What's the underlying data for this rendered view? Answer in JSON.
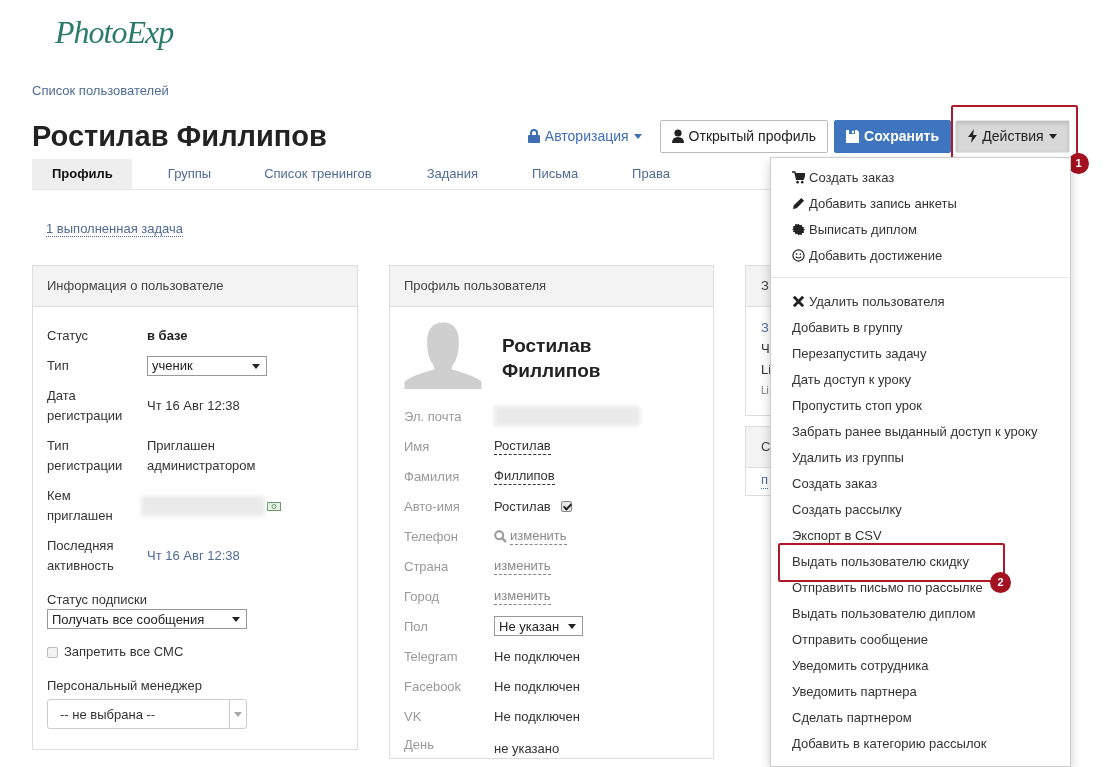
{
  "logo": {
    "text": "PhotoExp"
  },
  "breadcrumb": "Список пользователей",
  "title": "Ростилав Филлипов",
  "header_actions": {
    "auth": "Авторизация",
    "open_profile": "Открытый профиль",
    "save": "Сохранить",
    "actions": {
      "label": "Действия",
      "expanded": true,
      "annotation": "1"
    }
  },
  "tabs": [
    {
      "label": "Профиль",
      "selected": true
    },
    {
      "label": "Группы",
      "selected": false
    },
    {
      "label": "Список тренингов",
      "selected": false
    },
    {
      "label": "Задания",
      "selected": false
    },
    {
      "label": "Письма",
      "selected": false
    },
    {
      "label": "Права",
      "selected": false
    }
  ],
  "task_link": "1 выполненная задача",
  "info_panel": {
    "title": "Информация о пользователе",
    "rows": [
      {
        "kind": "bold",
        "label": "Статус",
        "value": "в базе"
      },
      {
        "kind": "select",
        "label": "Тип",
        "value": "ученик"
      },
      {
        "kind": "text",
        "label": "Дата регистрации",
        "value": "Чт 16 Авг 12:38"
      },
      {
        "kind": "text",
        "label": "Тип регистрации",
        "value": "Приглашен администратором"
      },
      {
        "kind": "redacted",
        "label": "Кем приглашен"
      },
      {
        "kind": "link",
        "label": "Последняя активность",
        "value": "Чт 16 Авг 12:38"
      }
    ],
    "subscription": {
      "label": "Статус подписки",
      "value": "Получать все сообщения"
    },
    "sms": {
      "label": "Запретить все СМС",
      "checked": false
    },
    "manager": {
      "label": "Персональный менеджер",
      "value": "-- не выбрана --"
    }
  },
  "profile_panel": {
    "title": "Профиль пользователя",
    "name": "Ростилав Филлипов",
    "rows": [
      {
        "kind": "redacted",
        "label": "Эл. почта"
      },
      {
        "kind": "editable",
        "label": "Имя",
        "value": "Ростилав"
      },
      {
        "kind": "editable",
        "label": "Фамилия",
        "value": "Филлипов"
      },
      {
        "kind": "check",
        "label": "Авто-имя",
        "value": "Ростилав",
        "checked": true
      },
      {
        "kind": "search",
        "label": "Телефон",
        "value": "изменить"
      },
      {
        "kind": "change",
        "label": "Страна",
        "value": "изменить"
      },
      {
        "kind": "change",
        "label": "Город",
        "value": "изменить"
      },
      {
        "kind": "select",
        "label": "Пол",
        "value": "Не указан"
      },
      {
        "kind": "text",
        "label": "Telegram",
        "value": "Не подключен"
      },
      {
        "kind": "text",
        "label": "Facebook",
        "value": "Не подключен"
      },
      {
        "kind": "text",
        "label": "VK",
        "value": "Не подключен"
      },
      {
        "kind": "low",
        "label": "День",
        "value": "не указано"
      }
    ]
  },
  "side_panels": [
    {
      "title": "З",
      "lines": [
        {
          "kind": "link",
          "text": "З"
        },
        {
          "kind": "text",
          "text": "Ч"
        },
        {
          "kind": "text",
          "text": "Li"
        },
        {
          "kind": "small",
          "text": "Li"
        }
      ]
    },
    {
      "title": "С",
      "lines": [
        {
          "kind": "dotted",
          "text": "п"
        }
      ]
    }
  ],
  "actions_menu": {
    "sections": [
      [
        {
          "label": "Создать заказ",
          "kind": "cart"
        },
        {
          "label": "Добавить запись анкеты",
          "kind": "pencil"
        },
        {
          "label": "Выписать диплом",
          "kind": "seal"
        },
        {
          "label": "Добавить достижение",
          "kind": "smile"
        }
      ],
      [
        {
          "label": "Удалить пользователя",
          "kind": "cross"
        },
        {
          "label": "Добавить в группу"
        },
        {
          "label": "Перезапустить задачу"
        },
        {
          "label": "Дать доступ к уроку"
        },
        {
          "label": "Пропустить стоп урок"
        },
        {
          "label": "Забрать ранее выданный доступ к уроку"
        },
        {
          "label": "Удалить из группы"
        },
        {
          "label": "Создать заказ"
        },
        {
          "label": "Создать рассылку"
        },
        {
          "label": "Экспорт в CSV"
        },
        {
          "label": "Выдать пользователю скидку",
          "annotation": "2"
        },
        {
          "label": "Отправить письмо по рассылке"
        },
        {
          "label": "Выдать пользователю диплом"
        },
        {
          "label": "Отправить сообщение"
        },
        {
          "label": "Уведомить сотрудника"
        },
        {
          "label": "Уведомить партнера"
        },
        {
          "label": "Сделать партнером"
        },
        {
          "label": "Добавить в категорию рассылок"
        }
      ]
    ]
  }
}
